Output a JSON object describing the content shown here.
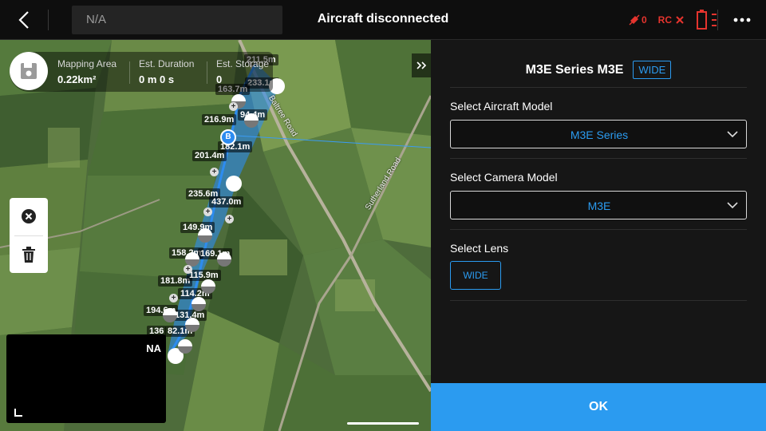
{
  "topbar": {
    "na_text": "N/A",
    "title": "Aircraft disconnected",
    "signal_count": "0",
    "rc_label": "RC",
    "icons": [
      "back-icon",
      "signal-icon",
      "rc-disconnected-icon",
      "battery-icon",
      "more-icon"
    ],
    "status_color": "#e5342e"
  },
  "map": {
    "stats": {
      "area_label": "Mapping Area",
      "area_value": "0.22km²",
      "duration_label": "Est. Duration",
      "duration_value": "0 m 0 s",
      "storage_label": "Est. Storage",
      "storage_value": "0"
    },
    "roads": [
      "Baltree Road",
      "Sutherland Road"
    ],
    "home_marker": "B",
    "distances": [
      "211.5m",
      "233.1m",
      "163.7m",
      "216.9m",
      "94.4m",
      "182.1m",
      "201.4m",
      "235.6m",
      "437.0m",
      "149.9m",
      "158.2m",
      "169.1m",
      "181.8m",
      "115.9m",
      "114.2m",
      "194.6m",
      "131.4m",
      "136",
      "82.1m"
    ],
    "pip_label": "NA"
  },
  "panel": {
    "header_title": "M3E Series M3E",
    "header_lens": "WIDE",
    "aircraft_label": "Select Aircraft Model",
    "aircraft_value": "M3E Series",
    "camera_label": "Select Camera Model",
    "camera_value": "M3E",
    "lens_label": "Select Lens",
    "lens_value": "WIDE",
    "ok_label": "OK",
    "accent": "#2b9bf0"
  }
}
